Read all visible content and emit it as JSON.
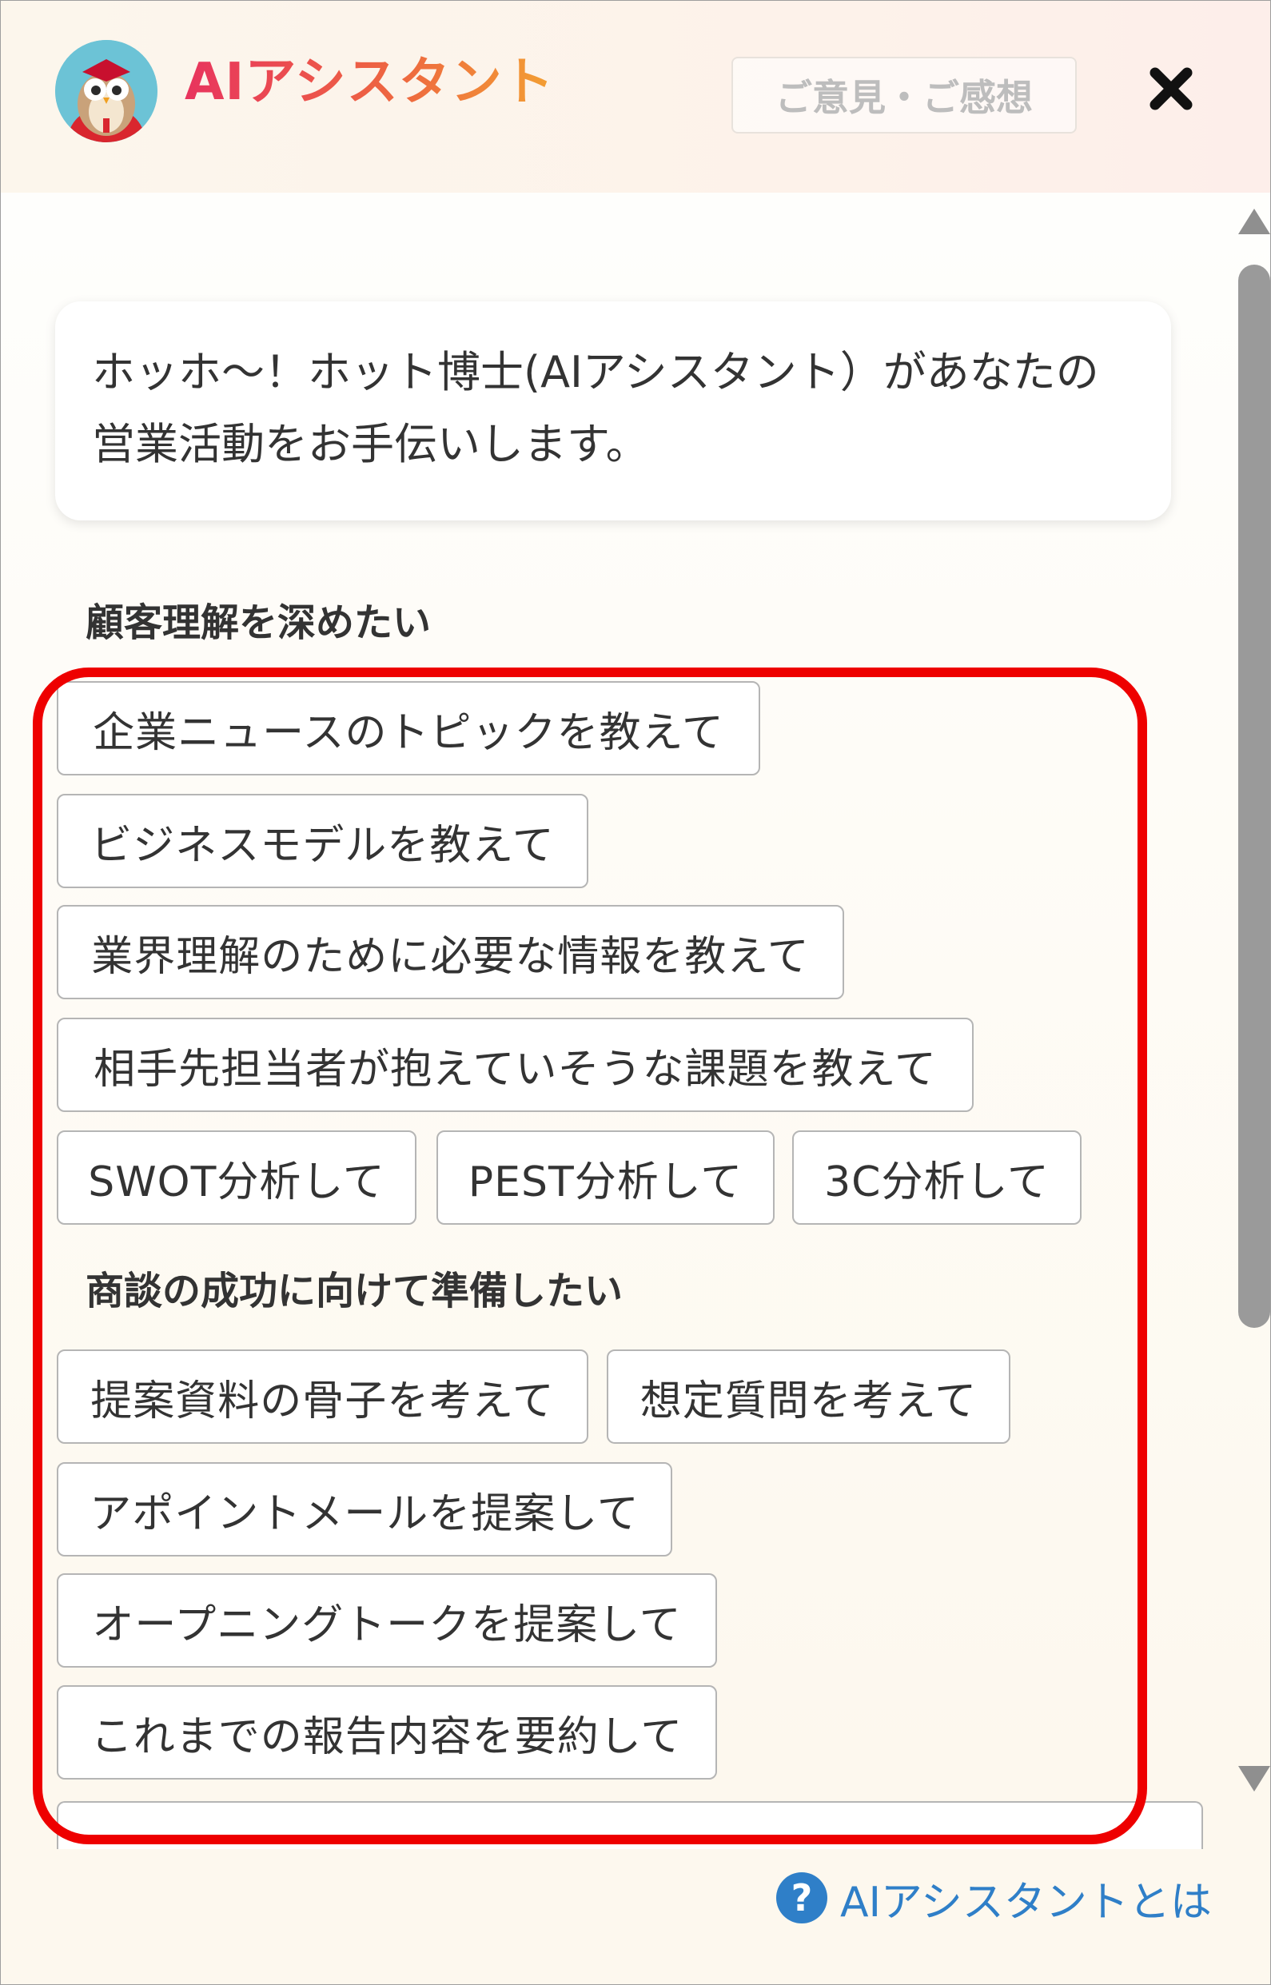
{
  "header": {
    "title": "AIアシスタント",
    "feedback_label": "ご意見・ご感想",
    "close_icon": "✖"
  },
  "intro": {
    "message": "ホッホ〜！ホット博士(AIアシスタント）があなたの営業活動をお手伝いします。"
  },
  "sections": [
    {
      "heading": "顧客理解を深めたい",
      "chips": [
        "企業ニュースのトピックを教えて",
        "ビジネスモデルを教えて",
        "業界理解のために必要な情報を教えて",
        "相手先担当者が抱えていそうな課題を教えて",
        "SWOT分析して",
        "PEST分析して",
        "3C分析して"
      ]
    },
    {
      "heading": "商談の成功に向けて準備したい",
      "chips": [
        "提案資料の骨子を考えて",
        "想定質問を考えて",
        "アポイントメールを提案して",
        "オープニングトークを提案して",
        "これまでの報告内容を要約して"
      ]
    }
  ],
  "footer": {
    "help_icon": "?",
    "link_label": "AIアシスタントとは"
  },
  "colors": {
    "title_gradient_start": "#e8345e",
    "title_gradient_end": "#f3a033",
    "link": "#2f7fc8",
    "highlight_border": "#ee0000"
  }
}
